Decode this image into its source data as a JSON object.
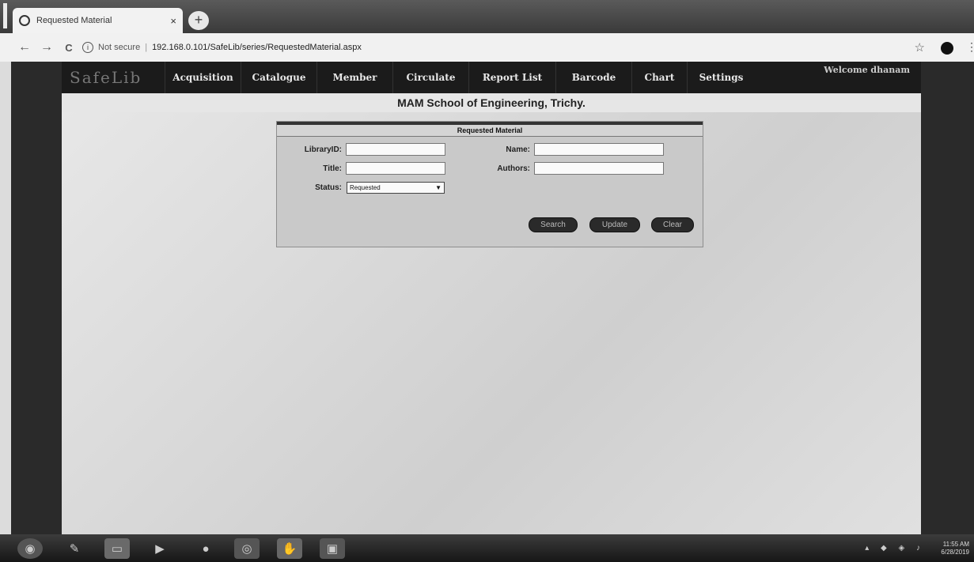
{
  "browser": {
    "tab_title": "Requested Material",
    "tab_close": "×",
    "new_tab": "+",
    "back": "←",
    "forward": "→",
    "reload": "C",
    "security_label": "Not secure",
    "url": "192.168.0.101/SafeLib/series/RequestedMaterial.aspx",
    "star": "☆",
    "menu": "⋮"
  },
  "app": {
    "logo": "SafeLib",
    "nav": [
      "Acquisition",
      "Catalogue",
      "Member",
      "Circulate",
      "Report List",
      "Barcode",
      "Chart",
      "Settings"
    ],
    "welcome": "Welcome dhanam",
    "school_title": "MAM School of Engineering, Trichy."
  },
  "form": {
    "title": "Requested Material",
    "libraryid_label": "LibraryID:",
    "title_label": "Title:",
    "status_label": "Status:",
    "name_label": "Name:",
    "authors_label": "Authors:",
    "status_value": "Requested",
    "buttons": {
      "search": "Search",
      "update": "Update",
      "clear": "Clear"
    }
  },
  "taskbar": {
    "clock_time": "11:55 AM",
    "clock_date": "6/28/2019"
  }
}
